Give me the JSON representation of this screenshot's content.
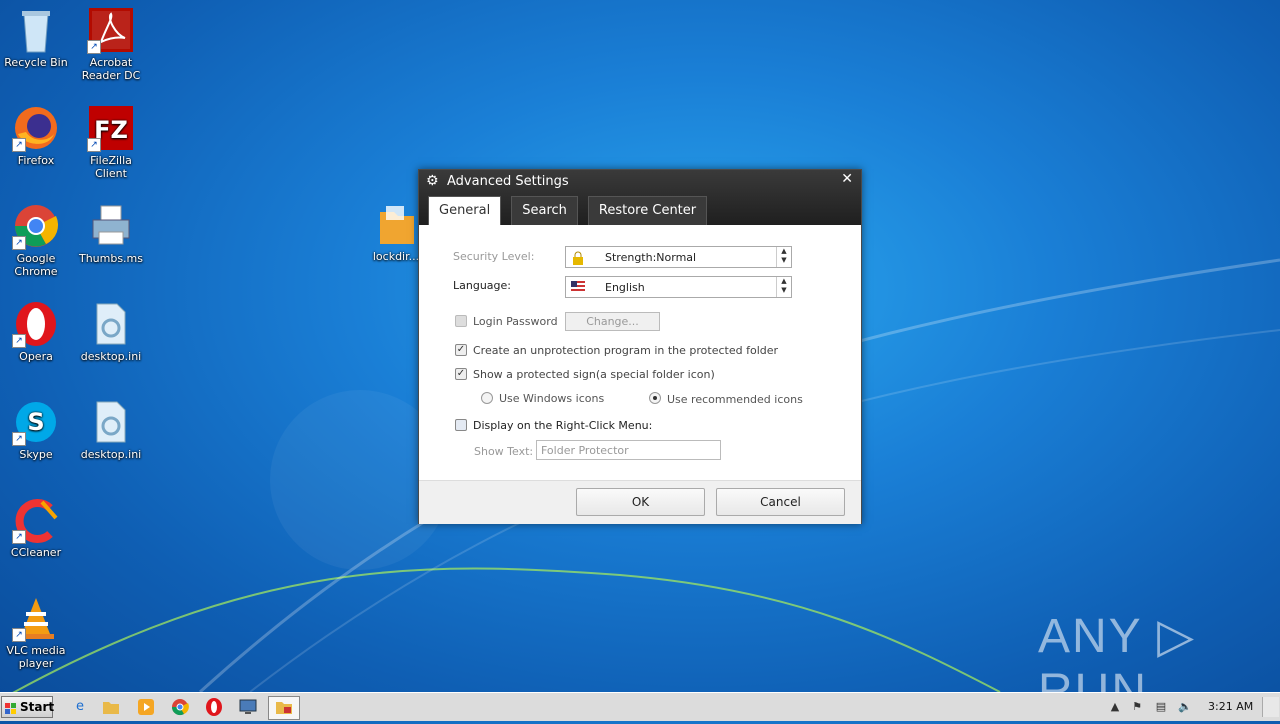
{
  "desktop": {
    "icons": [
      {
        "label": "Recycle Bin"
      },
      {
        "label": "Acrobat Reader DC"
      },
      {
        "label": "Firefox"
      },
      {
        "label": "FileZilla Client"
      },
      {
        "label": "Google Chrome"
      },
      {
        "label": "Thumbs.ms"
      },
      {
        "label": "Opera"
      },
      {
        "label": "desktop.ini"
      },
      {
        "label": "Skype"
      },
      {
        "label": "desktop.ini"
      },
      {
        "label": "CCleaner"
      },
      {
        "label": "VLC media player"
      },
      {
        "label": "lockdir..."
      }
    ]
  },
  "dialog": {
    "title": "Advanced Settings",
    "close": "✕",
    "tabs": [
      "General",
      "Search",
      "Restore Center"
    ],
    "active_tab": "General",
    "security_level_label": "Security Level:",
    "security_level_value": "Strength:Normal",
    "language_label": "Language:",
    "language_value": "English",
    "login_password_label": "Login Password",
    "change_button": "Change...",
    "unprotection_label": "Create an unprotection program in the protected folder",
    "unprotection_checked": true,
    "protected_sign_label": "Show a protected sign(a special folder icon)",
    "protected_sign_checked": true,
    "windows_icons_label": "Use Windows icons",
    "recommended_icons_label": "Use recommended icons",
    "right_click_label": "Display on the Right-Click Menu:",
    "show_text_label": "Show Text:",
    "show_text_placeholder": "Folder Protector",
    "ok": "OK",
    "cancel": "Cancel"
  },
  "taskbar": {
    "start": "Start",
    "clock": "3:21 AM"
  },
  "watermark": "ANY ▷ RUN"
}
